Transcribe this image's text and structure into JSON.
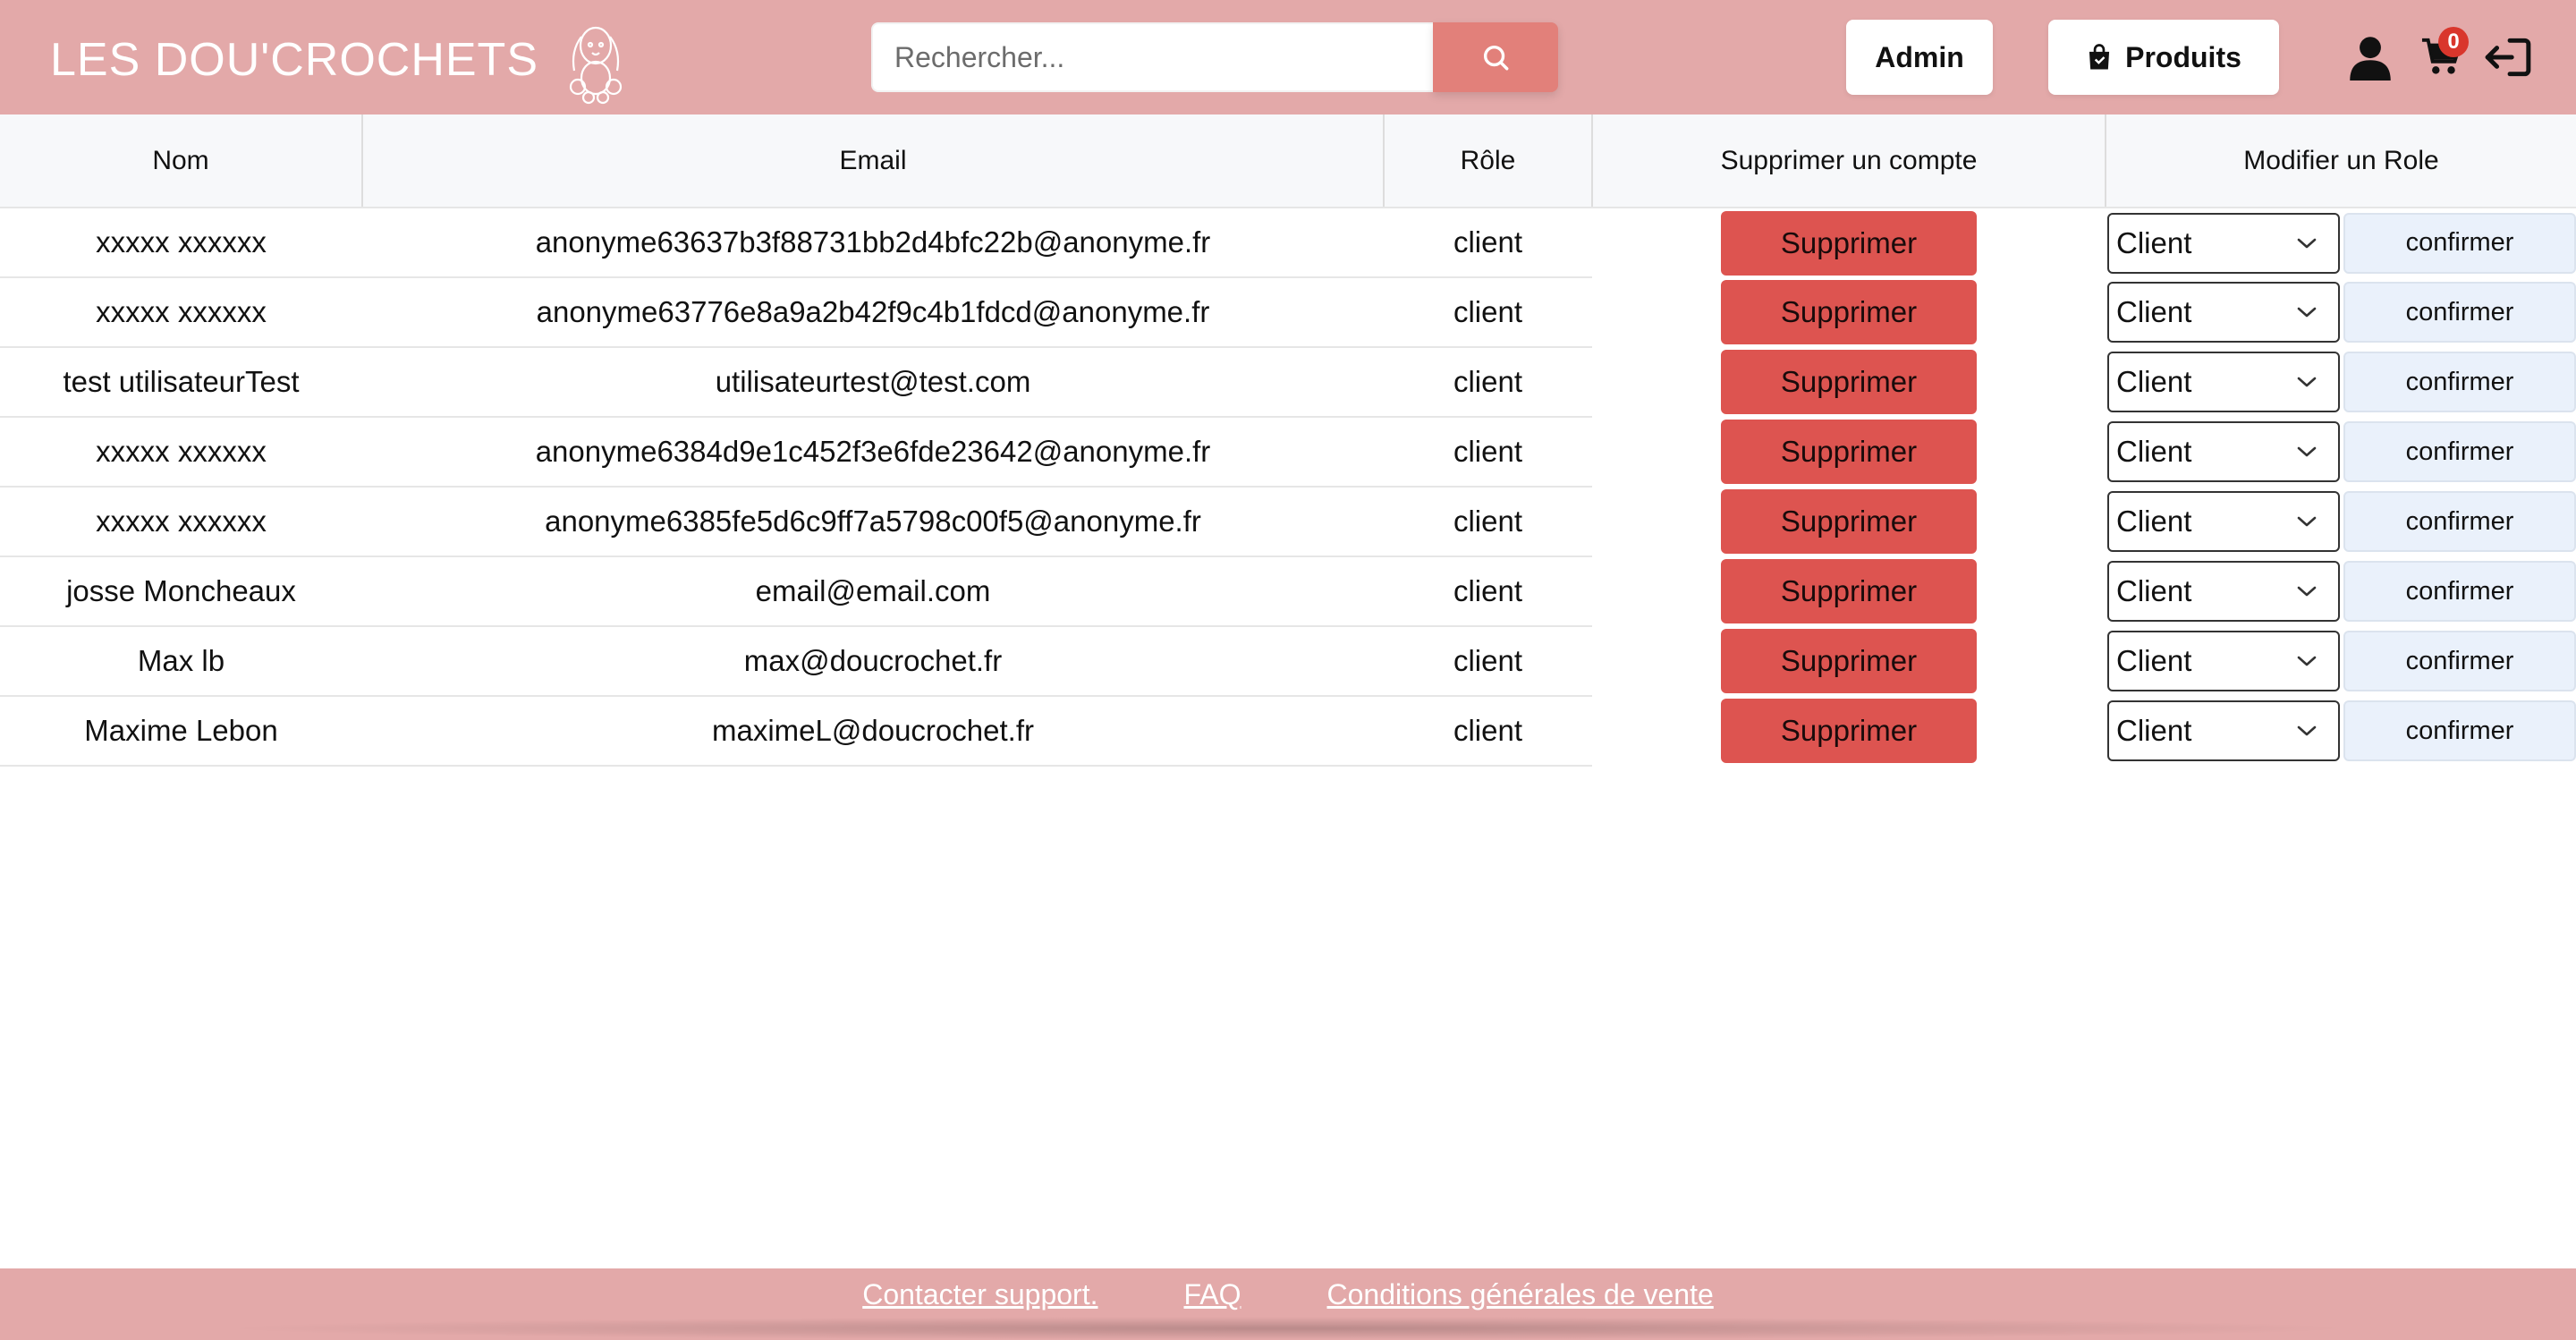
{
  "header": {
    "logo_text": "LES DOU'CROCHETS",
    "search_placeholder": "Rechercher...",
    "admin_label": "Admin",
    "products_label": "Produits",
    "cart_count": "0",
    "background_color": "#e3a9a9"
  },
  "table": {
    "columns": [
      "Nom",
      "Email",
      "Rôle",
      "Supprimer un compte",
      "Modifier un Role"
    ],
    "delete_label": "Supprimer",
    "confirm_label": "confirmer",
    "rows": [
      {
        "name": "xxxxx xxxxxx",
        "email": "anonyme63637b3f88731bb2d4bfc22b@anonyme.fr",
        "role": "client",
        "select": "Client"
      },
      {
        "name": "xxxxx xxxxxx",
        "email": "anonyme63776e8a9a2b42f9c4b1fdcd@anonyme.fr",
        "role": "client",
        "select": "Client"
      },
      {
        "name": "test utilisateurTest",
        "email": "utilisateurtest@test.com",
        "role": "client",
        "select": "Client"
      },
      {
        "name": "xxxxx xxxxxx",
        "email": "anonyme6384d9e1c452f3e6fde23642@anonyme.fr",
        "role": "client",
        "select": "Client"
      },
      {
        "name": "xxxxx xxxxxx",
        "email": "anonyme6385fe5d6c9ff7a5798c00f5@anonyme.fr",
        "role": "client",
        "select": "Client"
      },
      {
        "name": "josse Moncheaux",
        "email": "email@email.com",
        "role": "client",
        "select": "Client"
      },
      {
        "name": "Max lb",
        "email": "max@doucrochet.fr",
        "role": "client",
        "select": "Client"
      },
      {
        "name": "Maxime Lebon",
        "email": "maximeL@doucrochet.fr",
        "role": "client",
        "select": "Client"
      }
    ]
  },
  "footer": {
    "links": [
      "Contacter support.",
      "FAQ",
      "Conditions générales de vente"
    ]
  },
  "colors": {
    "accent": "#e3a9a9",
    "delete_button": "#dd5450",
    "search_button": "#e2807a",
    "badge": "#d9362c"
  },
  "icons": {
    "search": "search-icon",
    "user": "user-icon",
    "cart": "cart-icon",
    "logout": "logout-icon",
    "bag": "shopping-bag-icon",
    "logo": "bunny-logo-icon"
  }
}
